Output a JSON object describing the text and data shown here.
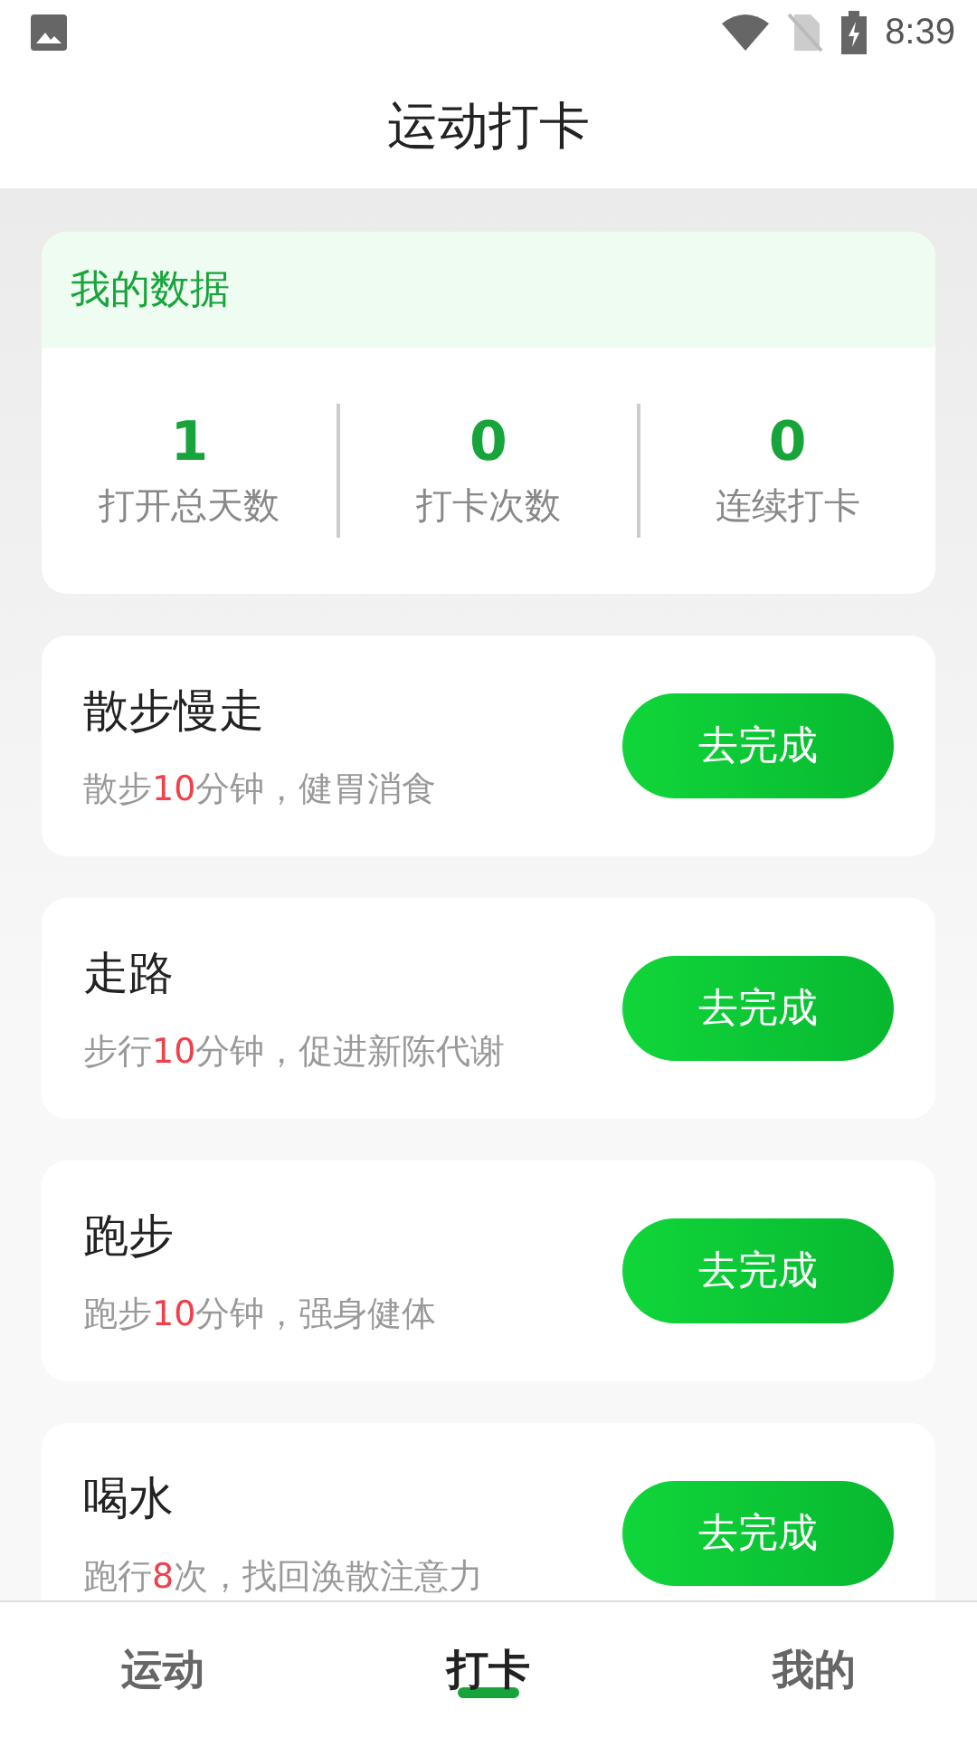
{
  "status_bar": {
    "time": "8:39"
  },
  "header": {
    "title": "运动打卡"
  },
  "stats": {
    "title": "我的数据",
    "items": [
      {
        "value": "1",
        "label": "打开总天数"
      },
      {
        "value": "0",
        "label": "打卡次数"
      },
      {
        "value": "0",
        "label": "连续打卡"
      }
    ]
  },
  "tasks": [
    {
      "title": "散步慢走",
      "desc": {
        "before": "散步",
        "number": "10",
        "after": "分钟，健胃消食"
      },
      "button": "去完成"
    },
    {
      "title": "走路",
      "desc": {
        "before": "步行",
        "number": "10",
        "after": "分钟，促进新陈代谢"
      },
      "button": "去完成"
    },
    {
      "title": "跑步",
      "desc": {
        "before": "跑步",
        "number": "10",
        "after": "分钟，强身健体"
      },
      "button": "去完成"
    },
    {
      "title": "喝水",
      "desc": {
        "before": "跑行",
        "number": "8",
        "after": "次，找回涣散注意力"
      },
      "button": "去完成"
    }
  ],
  "tabs": [
    {
      "label": "运动",
      "selected": false
    },
    {
      "label": "打卡",
      "selected": true
    },
    {
      "label": "我的",
      "selected": false
    }
  ]
}
